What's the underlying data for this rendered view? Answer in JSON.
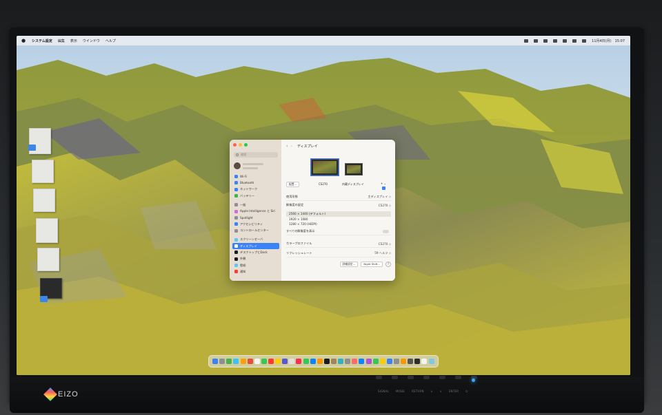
{
  "menubar": {
    "app_name": "システム設定",
    "menus": [
      "編集",
      "表示",
      "ウインドウ",
      "ヘルプ"
    ],
    "clock": "11月4日(月)　15:07"
  },
  "window": {
    "search_placeholder": "検索",
    "sidebar_items": [
      {
        "label": "Wi-Fi",
        "icon": "wifi-icon",
        "color": "#3b82f6"
      },
      {
        "label": "Bluetooth",
        "icon": "bluetooth-icon",
        "color": "#3b82f6"
      },
      {
        "label": "ネットワーク",
        "icon": "network-icon",
        "color": "#3b82f6"
      },
      {
        "label": "バッテリー",
        "icon": "battery-icon",
        "color": "#3cb54a"
      },
      {
        "label": "一般",
        "icon": "gear-icon",
        "color": "#8e8e93"
      },
      {
        "label": "Apple Intelligence と Siri",
        "icon": "siri-icon",
        "color": "#d06cd9"
      },
      {
        "label": "Spotlight",
        "icon": "spotlight-icon",
        "color": "#8e8e93"
      },
      {
        "label": "アクセシビリティ",
        "icon": "accessibility-icon",
        "color": "#3b82f6"
      },
      {
        "label": "コントロールセンター",
        "icon": "control-center-icon",
        "color": "#8e8e93"
      },
      {
        "label": "スクリーンセーバ",
        "icon": "screensaver-icon",
        "color": "#5ac8fa"
      },
      {
        "label": "ディスプレイ",
        "icon": "display-icon",
        "color": "#3b82f6",
        "active": true
      },
      {
        "label": "デスクトップとDock",
        "icon": "dock-icon",
        "color": "#1c1c1e"
      },
      {
        "label": "外観",
        "icon": "appearance-icon",
        "color": "#1c1c1e"
      },
      {
        "label": "壁紙",
        "icon": "wallpaper-icon",
        "color": "#5ac8fa"
      },
      {
        "label": "通知",
        "icon": "notifications-icon",
        "color": "#ff3b30"
      }
    ],
    "title": "ディスプレイ",
    "arrange_button": "配置...",
    "displays": [
      {
        "name": "CS270",
        "selected": true
      },
      {
        "name": "内蔵ディスプレイ",
        "selected": false
      }
    ],
    "plus_label": "+ ⌄",
    "use_as_label": "使用形態",
    "use_as_value": "主ディスプレイ ◇",
    "resolution_label": "解像度の設定",
    "resolution_value": "CS270 ◇",
    "resolutions": [
      "2560 × 1440 (デフォルト)",
      "1920 × 1080",
      "1280 × 720 (HiDPI)"
    ],
    "show_all_label": "すべての解像度を表示",
    "color_profile_label": "カラープロファイル",
    "color_profile_value": "CS270 ◇",
    "refresh_label": "リフレッシュレート",
    "refresh_value": "59 ヘルツ ◇",
    "advanced_button": "詳細設定...",
    "night_shift_button": "Night Shift...",
    "help": "?"
  },
  "monitor": {
    "brand": "EIZO",
    "button_labels": [
      "SIGNAL",
      "MODE",
      "RETURN",
      "∧",
      "∨",
      "ENTER",
      "⏻"
    ]
  },
  "dock_icon_colors": [
    "#3b82f6",
    "#8a8f98",
    "#4caf50",
    "#3cc2f5",
    "#ff9f0a",
    "#e74c3c",
    "#f5f5f5",
    "#34c759",
    "#ff3b30",
    "#ffcc00",
    "#5856d6",
    "#e0e0e0",
    "#ff2d55",
    "#34c759",
    "#0a84ff",
    "#ff9500",
    "#1c1c1e",
    "#a2845e",
    "#30b0c7",
    "#8e8e93",
    "#ff6b6b",
    "#0a84ff",
    "#af52de",
    "#34c759",
    "#ffcc00",
    "#3b82f6",
    "#8e8e93",
    "#ff9500",
    "#555555",
    "#2d2d2d",
    "#f2f2f7",
    "#7ec8e3"
  ]
}
